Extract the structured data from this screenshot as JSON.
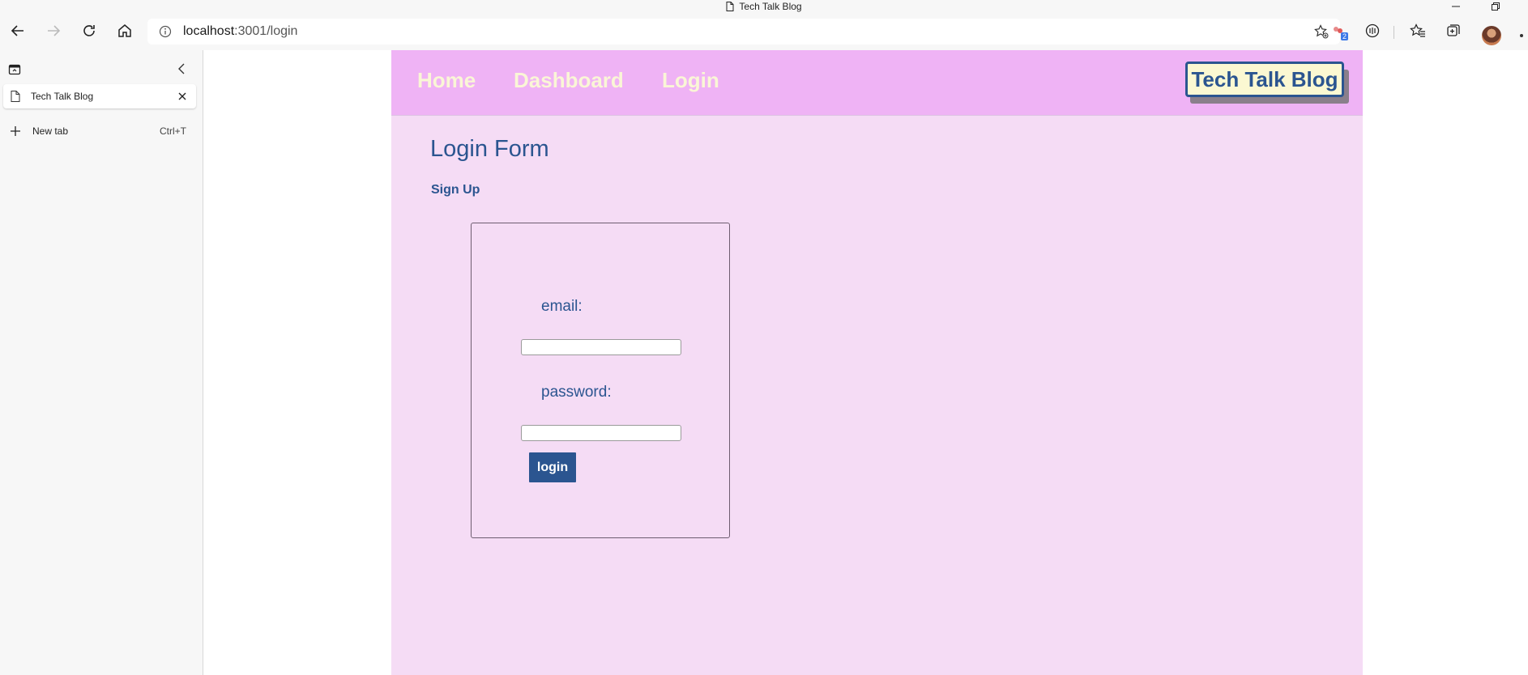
{
  "window": {
    "title": "Tech Talk Blog"
  },
  "browser": {
    "url_host": "localhost",
    "url_rest": ":3001/login",
    "extension_badge": "2"
  },
  "sidebar": {
    "tabs": [
      {
        "title": "Tech Talk Blog"
      }
    ],
    "new_tab_label": "New tab",
    "new_tab_shortcut": "Ctrl+T"
  },
  "site": {
    "nav": {
      "home": "Home",
      "dashboard": "Dashboard",
      "login": "Login"
    },
    "brand": "Tech Talk Blog",
    "page_title": "Login Form",
    "signup_link": "Sign Up",
    "form": {
      "email_label": "email:",
      "email_value": "",
      "password_label": "password:",
      "password_value": "",
      "submit_label": "login"
    }
  },
  "colors": {
    "header_bg": "#efb3f5",
    "page_bg": "#f5dcf5",
    "nav_text": "#faf6d6",
    "brand_blue": "#2b5590",
    "brand_bg": "#fbf8d2"
  }
}
